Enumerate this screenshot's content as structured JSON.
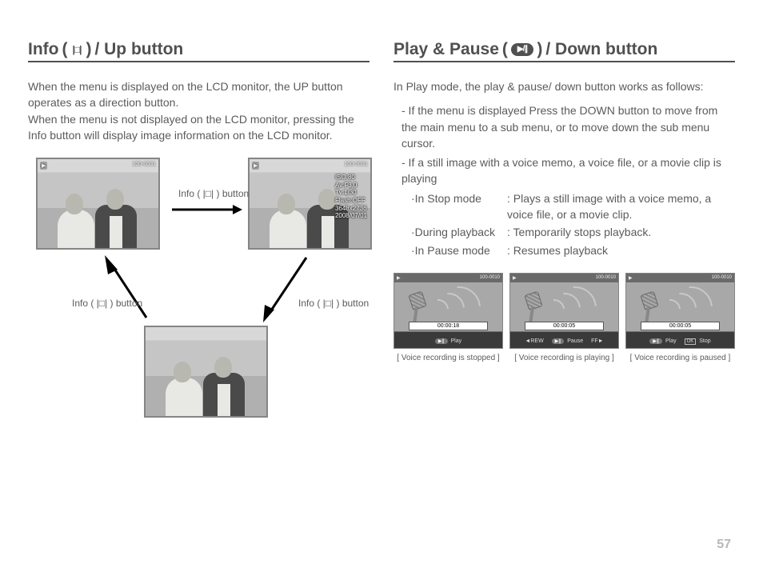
{
  "left": {
    "title_prefix": "Info",
    "title_paren_open": "(",
    "title_paren_close": ")",
    "title_suffix": " / Up button",
    "paragraph": "When the menu is displayed on the LCD monitor, the UP button operates as a direction button.\nWhen the menu is not displayed on the LCD monitor, pressing the Info button will display image information on the LCD monitor.",
    "thumb_topbar_file": "100-0031",
    "exif": {
      "iso": "ISO:80",
      "av": "Av:F3.0",
      "tv": "Tv:1/30",
      "flash": "Flash:OFF",
      "size": "3648x2736",
      "date": "2008/07/01"
    },
    "label_ab": "Info ( |□| ) button",
    "label_bc": "Info ( |□| ) button",
    "label_ca": "Info ( |□| ) button"
  },
  "right": {
    "title_prefix": "Play & Pause",
    "title_paren_open": " ( ",
    "title_paren_close": " )",
    "title_suffix": " / Down button",
    "intro": "In Play mode, the play & pause/ down button works as follows:",
    "b1": "- If the menu is displayed Press the DOWN button to move from the main menu to a sub menu, or to move down the sub menu cursor.",
    "b2": "- If a still image with a voice memo, a voice file, or a movie clip is playing",
    "modes": {
      "stop_label": "·In Stop mode",
      "stop_desc": ": Plays a still image with a voice memo, a voice file, or a movie clip.",
      "play_label": "·During playback",
      "play_desc": ": Temporarily stops playback.",
      "pause_label": "·In Pause mode",
      "pause_desc": ": Resumes playback"
    },
    "thumbs": {
      "file": "100-0010",
      "t1_time": "00:00:18",
      "t1_ctrl": "Play",
      "t1_caption": "[ Voice recording is stopped ]",
      "t2_time": "00:00:05",
      "t2_ctrl": "Pause",
      "t2_caption": "[ Voice recording is playing ]",
      "t3_time": "00:00:05",
      "t3_ctrl_a": "Play",
      "t3_ctrl_b": "Stop",
      "t3_ok": "OK",
      "t3_caption": "[ Voice recording is paused ]"
    }
  },
  "page_number": "57"
}
